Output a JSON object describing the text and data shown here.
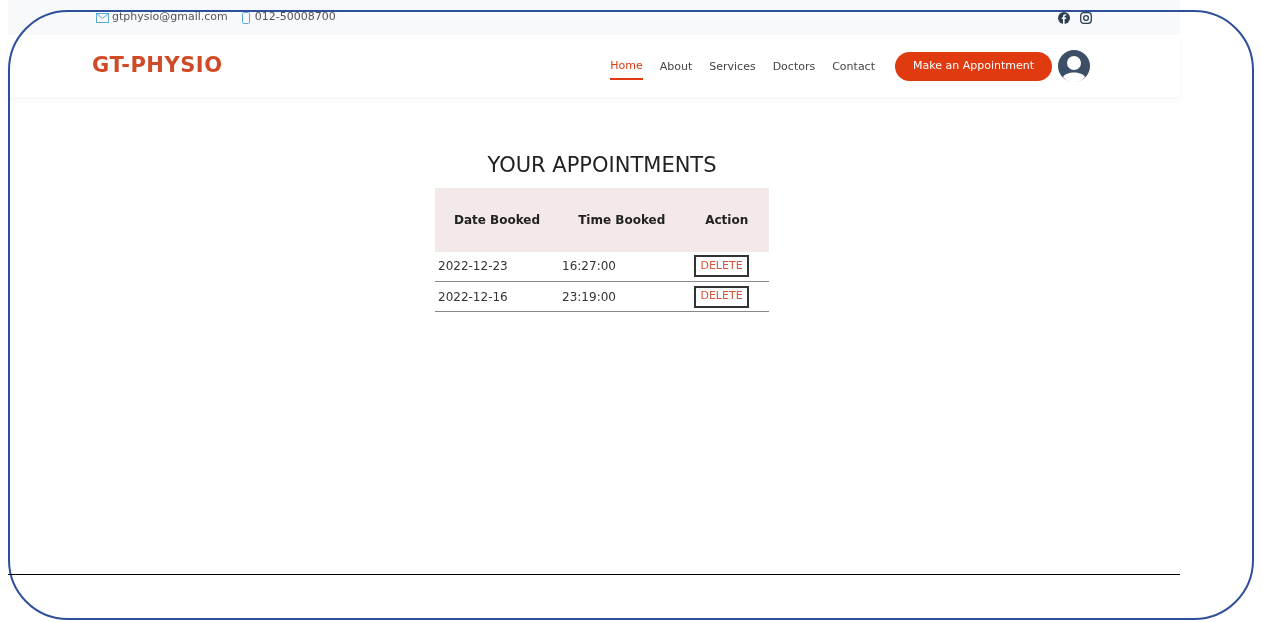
{
  "topbar": {
    "email": "gtphysio@gmail.com",
    "phone": "012-50008700"
  },
  "navbar": {
    "logo": "GT-PHYSIO",
    "links": [
      {
        "label": "Home",
        "selected": true
      },
      {
        "label": "About",
        "selected": false
      },
      {
        "label": "Services",
        "selected": false
      },
      {
        "label": "Doctors",
        "selected": false
      },
      {
        "label": "Contact",
        "selected": false
      }
    ],
    "cta": "Make an Appointment"
  },
  "heading": "YOUR APPOINTMENTS",
  "table": {
    "columns": [
      "Date Booked",
      "Time Booked",
      "Action"
    ],
    "rows": [
      {
        "date": "2022-12-23",
        "time": "16:27:00",
        "action": "DELETE"
      },
      {
        "date": "2022-12-16",
        "time": "23:19:00",
        "action": "DELETE"
      }
    ]
  }
}
